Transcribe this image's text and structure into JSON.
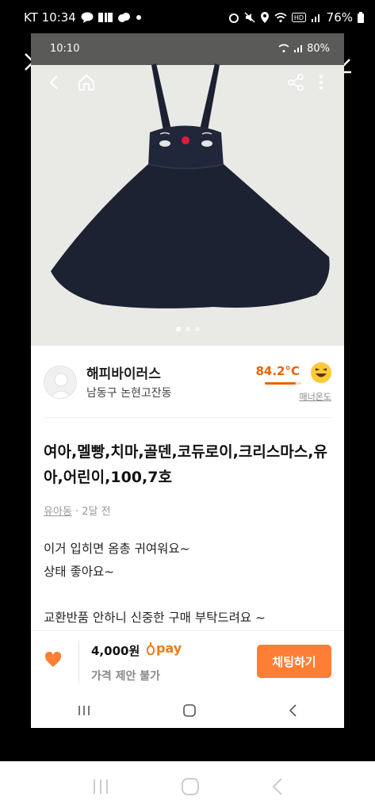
{
  "outer_status": {
    "carrier_time": "KT 10:34",
    "battery": "76%"
  },
  "inner_status": {
    "time": "10:10",
    "battery": "80%"
  },
  "seller": {
    "name": "해피바이러스",
    "location": "남동구 논현고잔동",
    "temperature": "84.2°C",
    "temperature_level": 0.842,
    "manner_label": "매너온도"
  },
  "product": {
    "title": "여아,멜빵,치마,골덴,코듀로이,크리스마스,유아,어린이,100,7호",
    "category": "유아동",
    "posted": " · 2달 전",
    "description_lines": [
      "이거 입히면 옴총 귀여워요~",
      "상태 좋아요~",
      "",
      "교환반품 안하니 신중한 구매 부탁드려요 ~"
    ]
  },
  "bottom": {
    "price": "4,000원",
    "pay_label": "pay",
    "negotiation": "가격 제안 불가",
    "chat_button": "채팅하기"
  },
  "image_carousel": {
    "current": 1,
    "total": 3
  },
  "colors": {
    "accent": "#ff7e36",
    "temp": "#e8620b"
  }
}
